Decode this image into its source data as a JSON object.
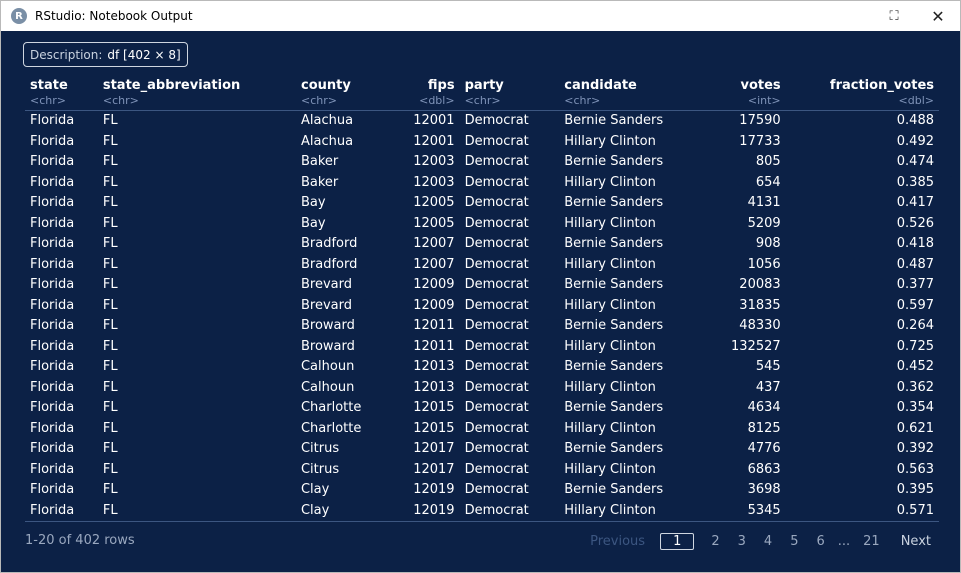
{
  "window": {
    "title": "RStudio: Notebook Output",
    "icon_letter": "R",
    "maximize_icon": "⛶",
    "close_icon": "✕"
  },
  "description": {
    "label": "Description:",
    "value": "df [402 × 8]"
  },
  "columns": [
    {
      "name": "state",
      "type": "<chr>",
      "align": "left"
    },
    {
      "name": "state_abbreviation",
      "type": "<chr>",
      "align": "left"
    },
    {
      "name": "county",
      "type": "<chr>",
      "align": "left"
    },
    {
      "name": "fips",
      "type": "<dbl>",
      "align": "right"
    },
    {
      "name": "party",
      "type": "<chr>",
      "align": "left"
    },
    {
      "name": "candidate",
      "type": "<chr>",
      "align": "left"
    },
    {
      "name": "votes",
      "type": "<int>",
      "align": "right"
    },
    {
      "name": "fraction_votes",
      "type": "<dbl>",
      "align": "right"
    }
  ],
  "rows": [
    [
      "Florida",
      "FL",
      "Alachua",
      "12001",
      "Democrat",
      "Bernie Sanders",
      "17590",
      "0.488"
    ],
    [
      "Florida",
      "FL",
      "Alachua",
      "12001",
      "Democrat",
      "Hillary Clinton",
      "17733",
      "0.492"
    ],
    [
      "Florida",
      "FL",
      "Baker",
      "12003",
      "Democrat",
      "Bernie Sanders",
      "805",
      "0.474"
    ],
    [
      "Florida",
      "FL",
      "Baker",
      "12003",
      "Democrat",
      "Hillary Clinton",
      "654",
      "0.385"
    ],
    [
      "Florida",
      "FL",
      "Bay",
      "12005",
      "Democrat",
      "Bernie Sanders",
      "4131",
      "0.417"
    ],
    [
      "Florida",
      "FL",
      "Bay",
      "12005",
      "Democrat",
      "Hillary Clinton",
      "5209",
      "0.526"
    ],
    [
      "Florida",
      "FL",
      "Bradford",
      "12007",
      "Democrat",
      "Bernie Sanders",
      "908",
      "0.418"
    ],
    [
      "Florida",
      "FL",
      "Bradford",
      "12007",
      "Democrat",
      "Hillary Clinton",
      "1056",
      "0.487"
    ],
    [
      "Florida",
      "FL",
      "Brevard",
      "12009",
      "Democrat",
      "Bernie Sanders",
      "20083",
      "0.377"
    ],
    [
      "Florida",
      "FL",
      "Brevard",
      "12009",
      "Democrat",
      "Hillary Clinton",
      "31835",
      "0.597"
    ],
    [
      "Florida",
      "FL",
      "Broward",
      "12011",
      "Democrat",
      "Bernie Sanders",
      "48330",
      "0.264"
    ],
    [
      "Florida",
      "FL",
      "Broward",
      "12011",
      "Democrat",
      "Hillary Clinton",
      "132527",
      "0.725"
    ],
    [
      "Florida",
      "FL",
      "Calhoun",
      "12013",
      "Democrat",
      "Bernie Sanders",
      "545",
      "0.452"
    ],
    [
      "Florida",
      "FL",
      "Calhoun",
      "12013",
      "Democrat",
      "Hillary Clinton",
      "437",
      "0.362"
    ],
    [
      "Florida",
      "FL",
      "Charlotte",
      "12015",
      "Democrat",
      "Bernie Sanders",
      "4634",
      "0.354"
    ],
    [
      "Florida",
      "FL",
      "Charlotte",
      "12015",
      "Democrat",
      "Hillary Clinton",
      "8125",
      "0.621"
    ],
    [
      "Florida",
      "FL",
      "Citrus",
      "12017",
      "Democrat",
      "Bernie Sanders",
      "4776",
      "0.392"
    ],
    [
      "Florida",
      "FL",
      "Citrus",
      "12017",
      "Democrat",
      "Hillary Clinton",
      "6863",
      "0.563"
    ],
    [
      "Florida",
      "FL",
      "Clay",
      "12019",
      "Democrat",
      "Bernie Sanders",
      "3698",
      "0.395"
    ],
    [
      "Florida",
      "FL",
      "Clay",
      "12019",
      "Democrat",
      "Hillary Clinton",
      "5345",
      "0.571"
    ]
  ],
  "footer": {
    "row_count": "1-20 of 402 rows",
    "previous_label": "Previous",
    "next_label": "Next",
    "current_page": "1",
    "pages": [
      "2",
      "3",
      "4",
      "5",
      "6"
    ],
    "ellipsis": "...",
    "last_page": "21"
  },
  "colors": {
    "background": "#0c2146",
    "text": "#ffffff",
    "muted": "#9aa8bf",
    "type_text": "#7f93b8",
    "divider": "#3c5681"
  }
}
